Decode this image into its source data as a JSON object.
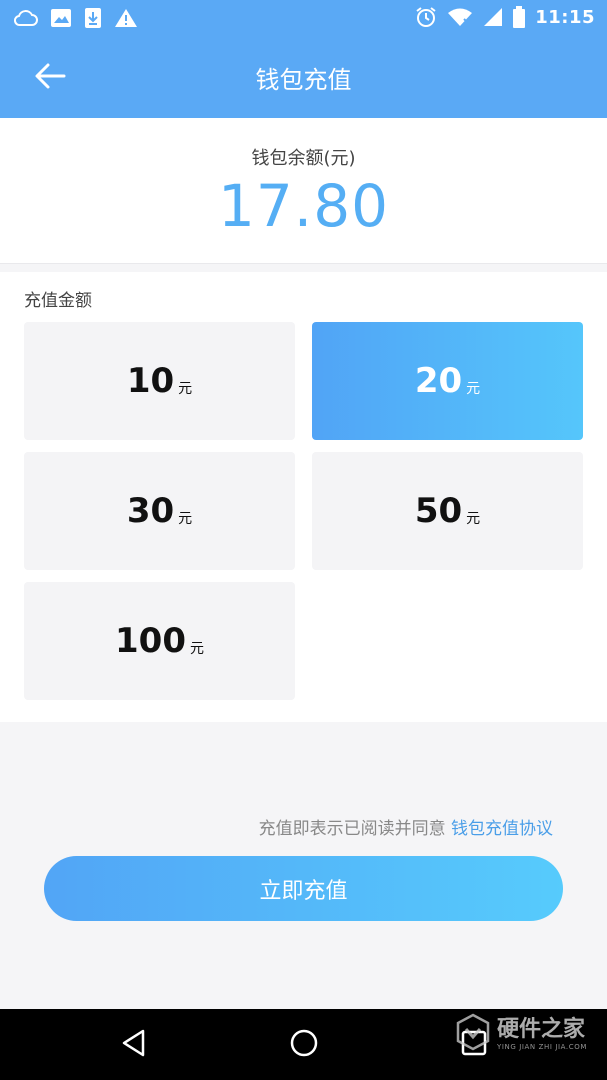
{
  "status_bar": {
    "time": "11:15",
    "left_icons": [
      "cloud-icon",
      "image-icon",
      "download-icon",
      "warning-icon"
    ],
    "right_icons": [
      "alarm-icon",
      "wifi-icon",
      "signal-icon",
      "battery-icon"
    ]
  },
  "header": {
    "title": "钱包充值",
    "back_icon": "arrow-left-icon",
    "bg_color": "#5aa9f5"
  },
  "balance": {
    "label": "钱包余额(元)",
    "amount": "17.80",
    "amount_color": "#55aef4"
  },
  "recharge": {
    "section_label": "充值金额",
    "unit": "元",
    "options": [
      {
        "amount": "10",
        "unit": "元",
        "selected": false
      },
      {
        "amount": "20",
        "unit": "元",
        "selected": true
      },
      {
        "amount": "30",
        "unit": "元",
        "selected": false
      },
      {
        "amount": "50",
        "unit": "元",
        "selected": false
      },
      {
        "amount": "100",
        "unit": "元",
        "selected": false
      }
    ]
  },
  "agreement": {
    "text": "充值即表示已阅读并同意",
    "link": "钱包充值协议"
  },
  "submit_label": "立即充值",
  "nav_bar": {
    "buttons": [
      "back-triangle-icon",
      "home-circle-icon",
      "recents-square-icon"
    ]
  },
  "watermark": {
    "title": "硬件之家",
    "subtitle": "YING JIAN ZHI JIA.COM"
  }
}
